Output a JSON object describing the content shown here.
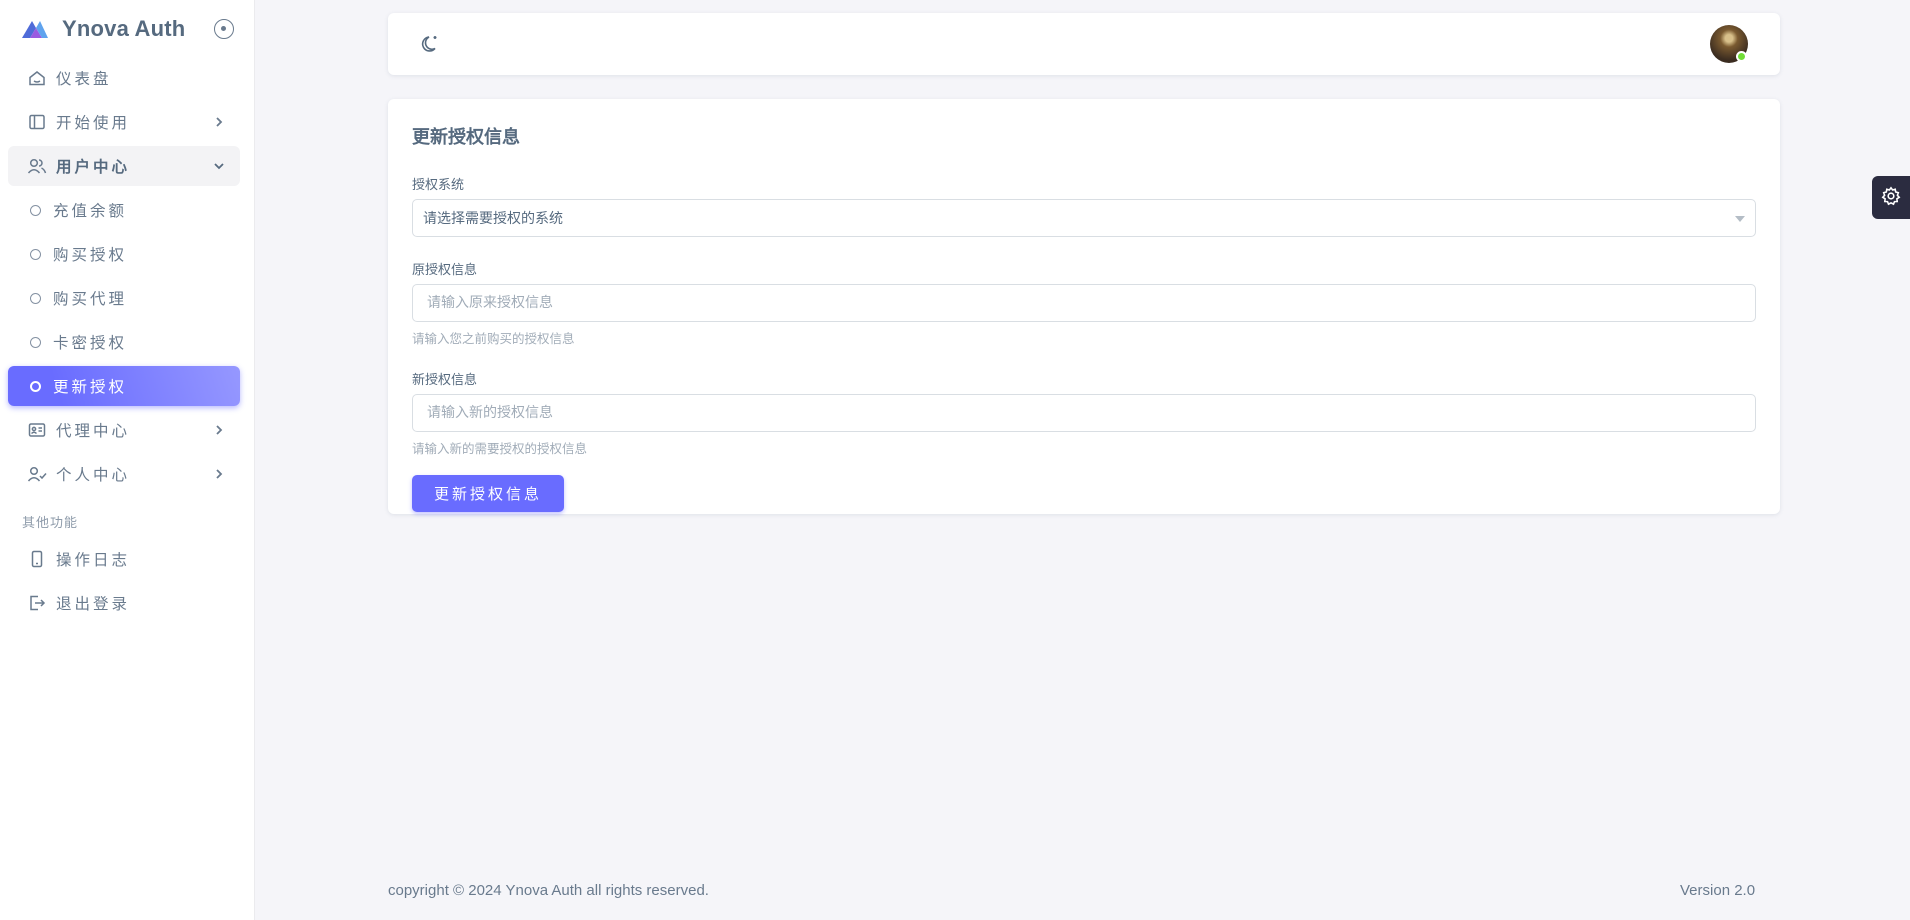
{
  "brand": {
    "name": "Ynova Auth"
  },
  "colors": {
    "primary": "#696cff",
    "sidebar_bg": "#ffffff",
    "page_bg": "#f5f5f9",
    "online": "#71dd37"
  },
  "sidebar": {
    "items": [
      {
        "label": "仪表盘",
        "icon": "home-icon"
      },
      {
        "label": "开始使用",
        "icon": "layout-icon"
      },
      {
        "label": "用户中心",
        "icon": "users-icon"
      },
      {
        "label": "代理中心",
        "icon": "id-card-icon"
      },
      {
        "label": "个人中心",
        "icon": "user-check-icon"
      }
    ],
    "user_center_sub": [
      {
        "label": "充值余额"
      },
      {
        "label": "购买授权"
      },
      {
        "label": "购买代理"
      },
      {
        "label": "卡密授权"
      },
      {
        "label": "更新授权"
      }
    ],
    "section_header": "其他功能",
    "other": [
      {
        "label": "操作日志",
        "icon": "mobile-icon"
      },
      {
        "label": "退出登录",
        "icon": "logout-icon"
      }
    ]
  },
  "main": {
    "title": "更新授权信息",
    "system_label": "授权系统",
    "system_selected": "请选择需要授权的系统",
    "old_label": "原授权信息",
    "old_placeholder": "请输入原来授权信息",
    "old_help": "请输入您之前购买的授权信息",
    "new_label": "新授权信息",
    "new_placeholder": "请输入新的授权信息",
    "new_help": "请输入新的需要授权的授权信息",
    "submit_label": "更新授权信息"
  },
  "footer": {
    "copyright": "copyright © 2024 Ynova Auth all rights reserved.",
    "version": "Version 2.0"
  }
}
